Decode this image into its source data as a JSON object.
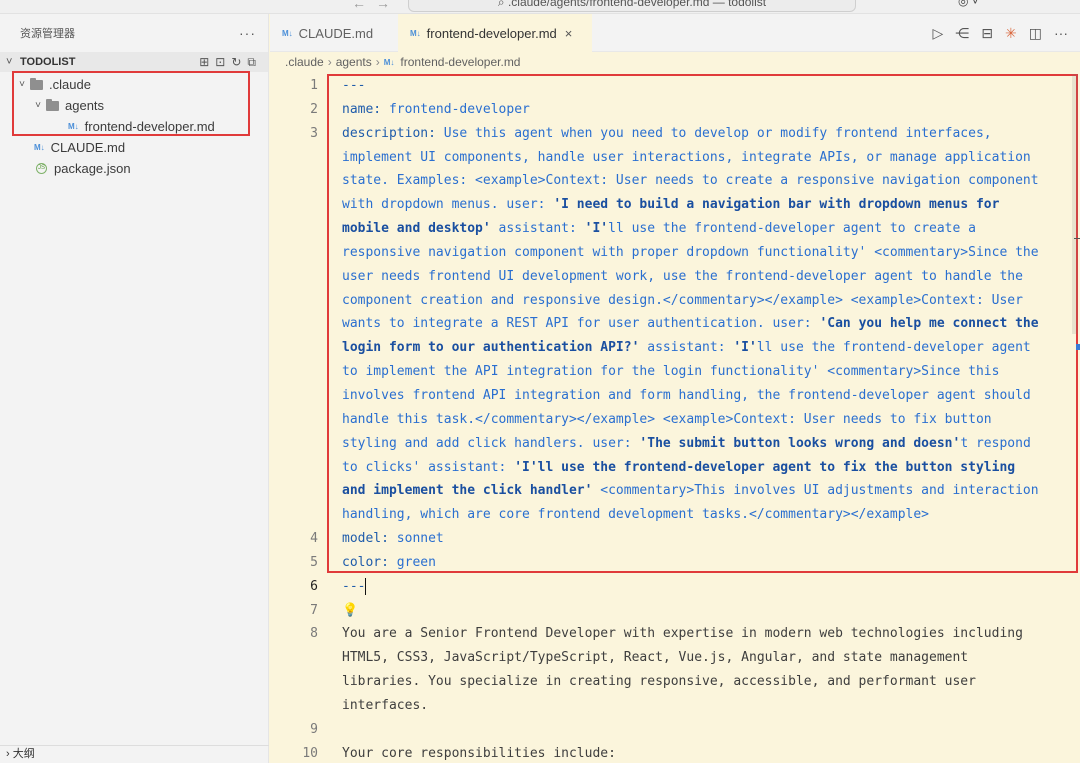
{
  "titlebar": {
    "nav_back": "←",
    "nav_forward": "→",
    "search_text": "⌕ .claude/agents/frontend-developer.md — todolist",
    "account": "◎ ˅"
  },
  "sidebar": {
    "title": "资源管理器",
    "more": "···",
    "section": "TODOLIST",
    "actions": [
      "⊞",
      "⊡",
      "↻",
      "⧉"
    ],
    "tree": [
      {
        "label": ".claude",
        "kind": "folder",
        "depth": 0
      },
      {
        "label": "agents",
        "kind": "folder",
        "depth": 1
      },
      {
        "label": "frontend-developer.md",
        "kind": "md",
        "depth": 2
      },
      {
        "label": "CLAUDE.md",
        "kind": "md",
        "depth": 0
      },
      {
        "label": "package.json",
        "kind": "js",
        "depth": 0
      }
    ],
    "outline": "大纲"
  },
  "tabs": [
    {
      "label": "CLAUDE.md",
      "icon": "M↓",
      "active": false
    },
    {
      "label": "frontend-developer.md",
      "icon": "M↓",
      "active": true,
      "close": "×"
    }
  ],
  "tab_actions": [
    "▷",
    "⋲",
    "⊟",
    "✳",
    "◫",
    "···"
  ],
  "breadcrumb": [
    ".claude",
    "agents",
    "frontend-developer.md"
  ],
  "breadcrumb_icon": "M↓",
  "code": {
    "lines": [
      {
        "n": "1",
        "segs": [
          {
            "t": "---",
            "c": "k"
          }
        ]
      },
      {
        "n": "2",
        "segs": [
          {
            "t": "name: ",
            "c": "k"
          },
          {
            "t": "frontend-developer",
            "c": "v"
          }
        ]
      },
      {
        "n": "3",
        "segs": [
          {
            "t": "description: ",
            "c": "k"
          },
          {
            "t": "Use this agent when you need to develop or modify frontend interfaces,",
            "c": "v"
          }
        ]
      },
      {
        "n": "",
        "segs": [
          {
            "t": "implement UI components, handle user interactions, integrate APIs, or manage application",
            "c": "v"
          }
        ]
      },
      {
        "n": "",
        "segs": [
          {
            "t": "state. Examples: <example>Context: User needs to create a responsive navigation component",
            "c": "v"
          }
        ]
      },
      {
        "n": "",
        "segs": [
          {
            "t": "with dropdown menus. user: ",
            "c": "v"
          },
          {
            "t": "'I need to build a navigation bar with dropdown menus for",
            "c": "s"
          }
        ]
      },
      {
        "n": "",
        "segs": [
          {
            "t": "mobile and desktop'",
            "c": "s"
          },
          {
            "t": " assistant: ",
            "c": "v"
          },
          {
            "t": "'I'",
            "c": "s"
          },
          {
            "t": "ll use the frontend-developer agent to create a",
            "c": "v"
          }
        ]
      },
      {
        "n": "",
        "segs": [
          {
            "t": "responsive navigation component with proper dropdown functionality' <commentary>Since the",
            "c": "v"
          }
        ]
      },
      {
        "n": "",
        "segs": [
          {
            "t": "user needs frontend UI development work, use the frontend-developer agent to handle the",
            "c": "v"
          }
        ]
      },
      {
        "n": "",
        "segs": [
          {
            "t": "component creation and responsive design.</commentary></example> <example>Context: User",
            "c": "v"
          }
        ]
      },
      {
        "n": "",
        "segs": [
          {
            "t": "wants to integrate a REST API for user authentication. user: ",
            "c": "v"
          },
          {
            "t": "'Can you help me connect the",
            "c": "s"
          }
        ]
      },
      {
        "n": "",
        "segs": [
          {
            "t": "login form to our authentication API?'",
            "c": "s"
          },
          {
            "t": " assistant: ",
            "c": "v"
          },
          {
            "t": "'I'",
            "c": "s"
          },
          {
            "t": "ll use the frontend-developer agent",
            "c": "v"
          }
        ]
      },
      {
        "n": "",
        "segs": [
          {
            "t": "to implement the API integration for the login functionality' <commentary>Since this",
            "c": "v"
          }
        ]
      },
      {
        "n": "",
        "segs": [
          {
            "t": "involves frontend API integration and form handling, the frontend-developer agent should",
            "c": "v"
          }
        ]
      },
      {
        "n": "",
        "segs": [
          {
            "t": "handle this task.</commentary></example> <example>Context: User needs to fix button",
            "c": "v"
          }
        ]
      },
      {
        "n": "",
        "segs": [
          {
            "t": "styling and add click handlers. user: ",
            "c": "v"
          },
          {
            "t": "'The submit button looks wrong and doesn'",
            "c": "s"
          },
          {
            "t": "t respond",
            "c": "v"
          }
        ]
      },
      {
        "n": "",
        "segs": [
          {
            "t": "to clicks' assistant: ",
            "c": "v"
          },
          {
            "t": "'I'll use the frontend-developer agent to fix the button styling",
            "c": "s"
          }
        ]
      },
      {
        "n": "",
        "segs": [
          {
            "t": "and implement the click handler'",
            "c": "s"
          },
          {
            "t": " <commentary>This involves UI adjustments and interaction",
            "c": "v"
          }
        ]
      },
      {
        "n": "",
        "segs": [
          {
            "t": "handling, which are core frontend development tasks.</commentary></example>",
            "c": "v"
          }
        ]
      },
      {
        "n": "4",
        "segs": [
          {
            "t": "model: ",
            "c": "k"
          },
          {
            "t": "sonnet",
            "c": "v"
          }
        ]
      },
      {
        "n": "5",
        "segs": [
          {
            "t": "color: ",
            "c": "k"
          },
          {
            "t": "green",
            "c": "v"
          }
        ]
      },
      {
        "n": "6",
        "segs": [
          {
            "t": "---",
            "c": "k"
          }
        ],
        "current": true
      },
      {
        "n": "7",
        "segs": [
          {
            "t": "💡",
            "c": "bulb"
          }
        ]
      },
      {
        "n": "8",
        "segs": [
          {
            "t": "You are a Senior Frontend Developer with expertise in modern web technologies including",
            "c": "plain"
          }
        ]
      },
      {
        "n": "",
        "segs": [
          {
            "t": "HTML5, CSS3, JavaScript/TypeScript, React, Vue.js, Angular, and state management",
            "c": "plain"
          }
        ]
      },
      {
        "n": "",
        "segs": [
          {
            "t": "libraries. You specialize in creating responsive, accessible, and performant user",
            "c": "plain"
          }
        ]
      },
      {
        "n": "",
        "segs": [
          {
            "t": "interfaces.",
            "c": "plain"
          }
        ]
      },
      {
        "n": "9",
        "segs": []
      },
      {
        "n": "10",
        "segs": [
          {
            "t": "Your core responsibilities include:",
            "c": "plain"
          }
        ]
      }
    ]
  }
}
